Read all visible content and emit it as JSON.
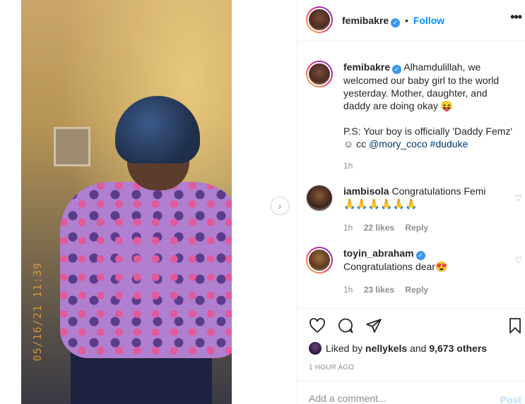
{
  "header": {
    "username": "femibakre",
    "separator": "•",
    "follow_label": "Follow",
    "more_icon": "•••"
  },
  "caption": {
    "username": "femibakre",
    "text": "Alhamdulillah, we welcomed our baby girl to the world yesterday. Mother, daughter, and daddy are doing okay 😝",
    "ps_text": "P.S: Your boy is officially 'Daddy Femz' ☺ cc ",
    "mention": "@mory_coco",
    "hashtag": "#duduke",
    "time": "1h"
  },
  "comments": [
    {
      "username": "iambisola",
      "text": "Congratulations Femi 🙏🙏🙏🙏🙏🙏",
      "time": "1h",
      "likes": "22 likes",
      "reply_label": "Reply"
    },
    {
      "username": "toyin_abraham",
      "text": "Congratulations dear😍",
      "time": "1h",
      "likes": "23 likes",
      "reply_label": "Reply"
    }
  ],
  "likes": {
    "prefix": "Liked by ",
    "user": "nellykels",
    "connector": " and ",
    "others": "9,673 others"
  },
  "time_ago": "1 HOUR AGO",
  "add_comment": {
    "placeholder": "Add a comment...",
    "post_label": "Post"
  },
  "photo": {
    "timestamp_stamp": "05/16/21 11:39"
  },
  "colors": {
    "accent": "#0095f6",
    "verified": "#3897f0",
    "post_disabled": "#b2dffc",
    "muted": "#8e8e8e"
  },
  "icons": {
    "next": "chevron-right-icon",
    "like": "heart-icon",
    "comment": "comment-bubble-icon",
    "share": "paper-plane-icon",
    "save": "bookmark-icon"
  }
}
